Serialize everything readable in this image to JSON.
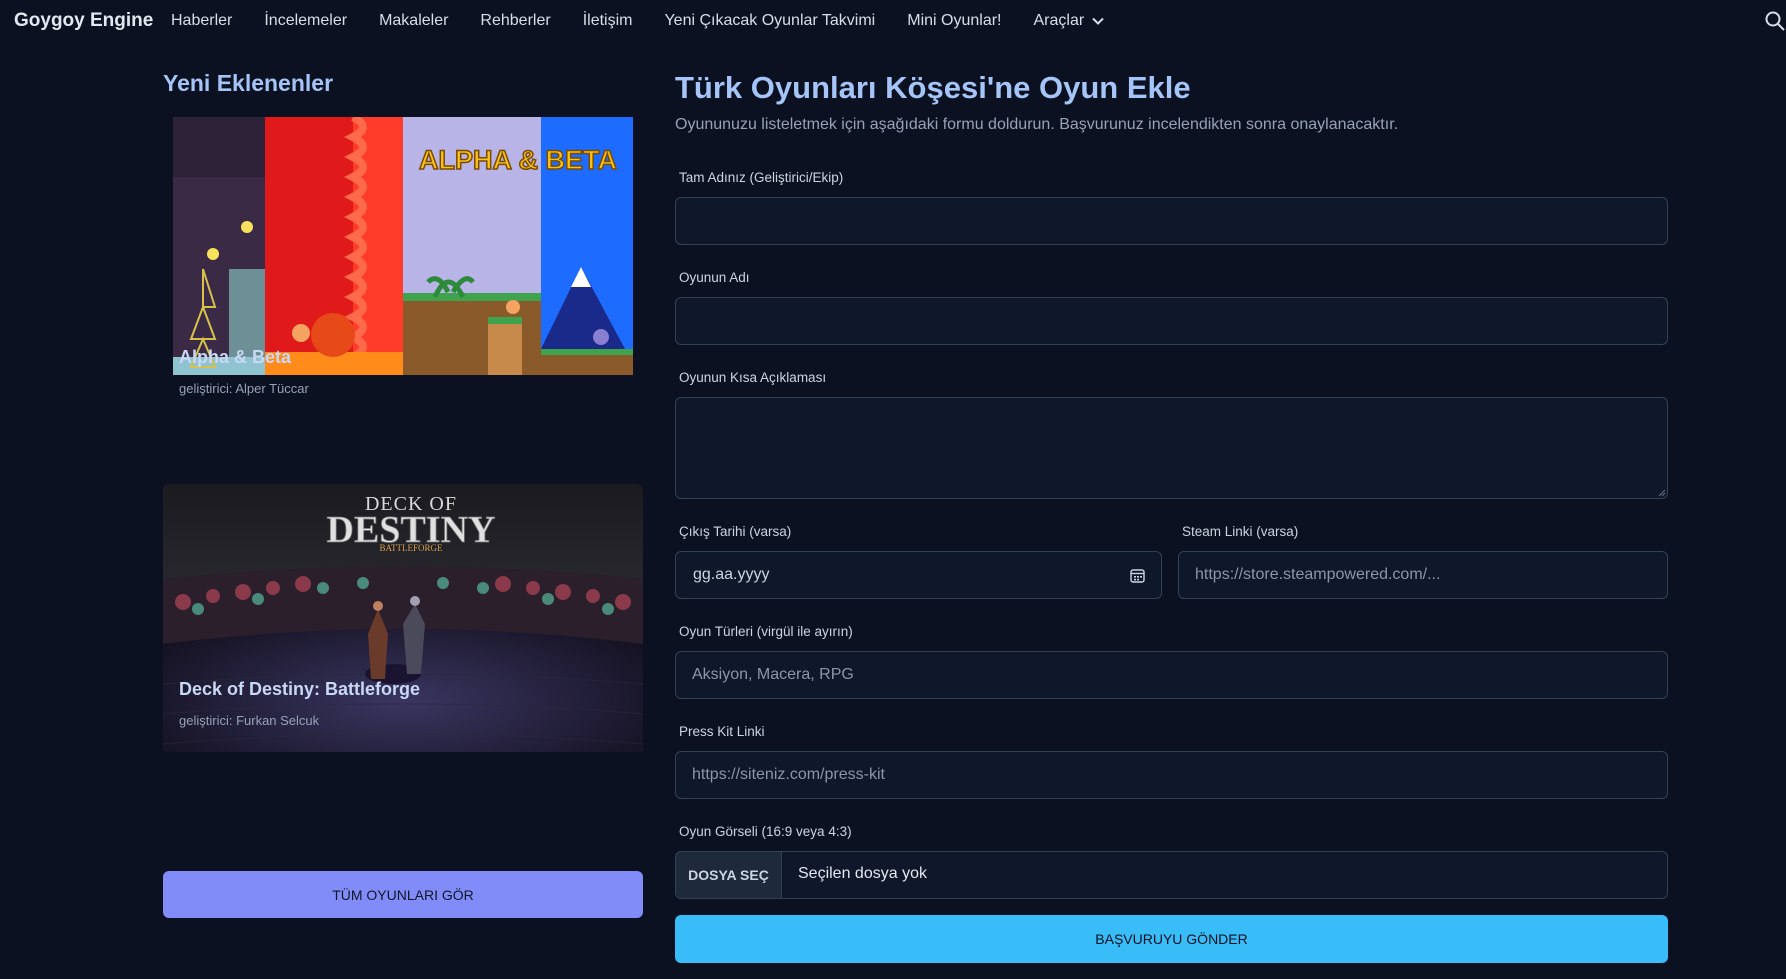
{
  "nav": {
    "brand": "Goygoy Engine",
    "links": [
      "Haberler",
      "İncelemeler",
      "Makaleler",
      "Rehberler",
      "İletişim",
      "Yeni Çıkacak Oyunlar Takvimi",
      "Mini Oyunlar!"
    ],
    "dropdown": "Araçlar",
    "search_icon": "search-icon"
  },
  "sidebar": {
    "title": "Yeni Eklenenler",
    "games": [
      {
        "title": "Alpha & Beta",
        "developer": "geliştirici: Alper Tüccar",
        "image_text": "ALPHA & BETA"
      },
      {
        "title": "Deck of Destiny: Battleforge",
        "developer": "geliştirici: Furkan Selcuk",
        "image_text_1": "DECK OF",
        "image_text_2": "DESTINY",
        "image_text_3": "BATTLEFORGE"
      }
    ],
    "all_button": "TÜM OYUNLARI GÖR"
  },
  "form": {
    "title": "Türk Oyunları Köşesi'ne Oyun Ekle",
    "subtitle": "Oyununuzu listeletmek için aşağıdaki formu doldurun. Başvurunuz incelendikten sonra onaylanacaktır.",
    "name_label": "Tam Adınız (Geliştirici/Ekip)",
    "game_name_label": "Oyunun Adı",
    "desc_label": "Oyunun Kısa Açıklaması",
    "date_label": "Çıkış Tarihi (varsa)",
    "date_value": "gg.aa.yyyy",
    "steam_label": "Steam Linki (varsa)",
    "steam_placeholder": "https://store.steampowered.com/...",
    "genres_label": "Oyun Türleri (virgül ile ayırın)",
    "genres_placeholder": "Aksiyon, Macera, RPG",
    "presskit_label": "Press Kit Linki",
    "presskit_placeholder": "https://siteniz.com/press-kit",
    "image_label": "Oyun Görseli (16:9 veya 4:3)",
    "file_button": "DOSYA SEÇ",
    "file_status": "Seçilen dosya yok",
    "submit": "BAŞVURUYU GÖNDER"
  },
  "colors": {
    "background": "#0b1120",
    "heading": "#a5c4f7",
    "all_button": "#818cf8",
    "submit_button": "#38bdf8"
  }
}
